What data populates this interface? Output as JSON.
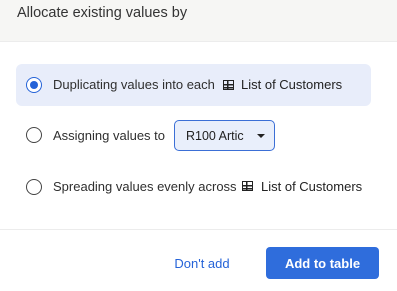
{
  "header": {
    "title": "Allocate existing values by"
  },
  "options": [
    {
      "label": "Duplicating values into each",
      "target": "List of Customers",
      "selected": true
    },
    {
      "label": "Assigning values to",
      "dropdown_value": "R100 Artic",
      "selected": false
    },
    {
      "label": "Spreading values evenly across",
      "target": "List of Customers",
      "selected": false
    }
  ],
  "footer": {
    "cancel_label": "Don't add",
    "confirm_label": "Add to table"
  },
  "colors": {
    "accent": "#2f6ddc",
    "selected_bg": "#e8edfa",
    "header_bg": "#f6f6f4"
  },
  "icons": {
    "table": "table-icon",
    "dropdown": "chevron-down-icon"
  }
}
